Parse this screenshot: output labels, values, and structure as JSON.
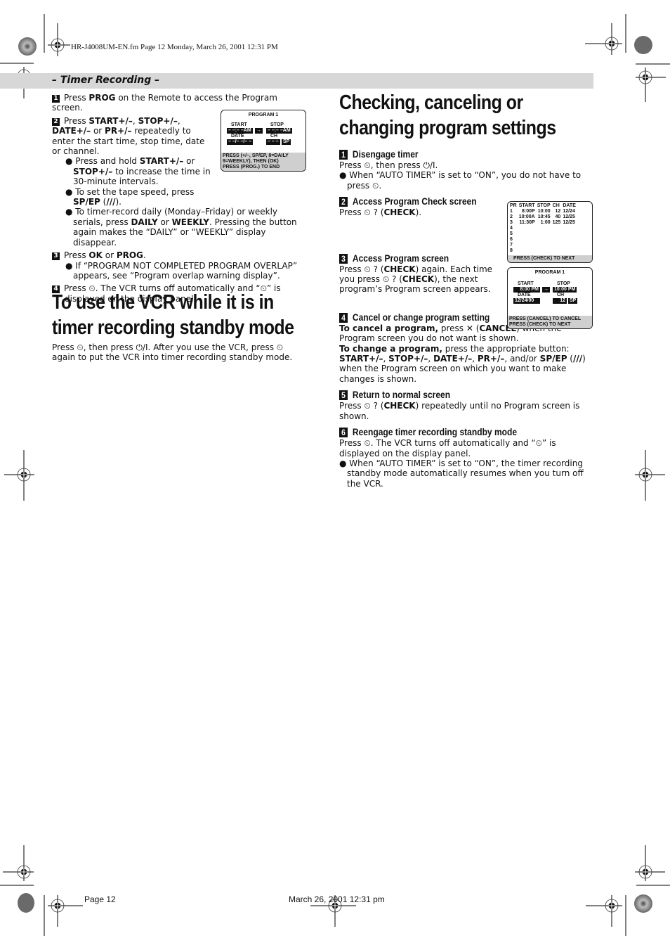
{
  "file_header": "HR-J4008UM-EN.fm  Page 12  Monday, March 26, 2001  12:31 PM",
  "section_title": "– Timer Recording –",
  "left": {
    "steps": [
      {
        "num": "1",
        "html_parts": [
          "Press ",
          "PROG",
          " on the Remote to access the Program screen."
        ]
      },
      {
        "num": "2",
        "text_a": "Press ",
        "b1": "START+/–",
        "t1": ", ",
        "b2": "STOP+/–",
        "t2": ", ",
        "b3": "DATE+/–",
        "t3": " or ",
        "b4": "PR+/–",
        "t4": " repeatedly to enter the start time, stop time, date or channel.",
        "bullets": [
          {
            "a": "Press and hold ",
            "b": "START+/–",
            "c": " or ",
            "d": "STOP+/–",
            "e": " to increase the time in 30-minute intervals."
          },
          {
            "a": "To set the tape speed, press ",
            "b": "SP/EP",
            "c": " (",
            "d": "///",
            "e": ")."
          },
          {
            "a": "To timer-record daily (Monday–Friday) or weekly serials, press ",
            "b": "DAILY",
            "c": " or ",
            "d": "WEEKLY",
            "e": ". Pressing the button again makes the “DAILY” or “WEEKLY” display disappear."
          }
        ]
      },
      {
        "num": "3",
        "a": "Press ",
        "b": "OK",
        "c": " or ",
        "d": "PROG",
        "e": ".",
        "bullet": "If “PROGRAM NOT COMPLETED PROGRAM OVERLAP” appears, see “Program overlap warning display”."
      },
      {
        "num": "4",
        "text": "Press ⏲. The VCR turns off automatically and “⏲” is displayed on the display panel."
      }
    ],
    "program_screen": {
      "title": "PROGRAM 1",
      "start_label": "START",
      "stop_label": "STOP",
      "start_value": "– –:– –AM",
      "stop_value": "– –:– –AM",
      "date_label": "DATE",
      "ch_label": "CH",
      "date_value": "– –/– –/– –",
      "ch_value": "– – –",
      "speed": "SP",
      "footer": [
        "PRESS (+/–, SP/EP, 8=DAILY",
        "9=WEEKLY), THEN (OK)",
        "PRESS (PROG.) TO END"
      ]
    },
    "heading": "To use the VCR while it is in timer recording standby mode",
    "paragraph": "Press ⏲, then press ⏻/I. After you use the VCR, press ⏲ again to put the VCR into timer recording standby mode."
  },
  "right": {
    "heading": "Checking, canceling or changing program settings",
    "steps": [
      {
        "num": "1",
        "title": "Disengage timer",
        "text": "Press ⏲, then press ⏻/I.",
        "bullet": "When “AUTO TIMER” is set to “ON”, you do not have to press ⏲."
      },
      {
        "num": "2",
        "title": "Access Program Check screen",
        "a": "Press ⏲ ? (",
        "b": "CHECK",
        "c": ")."
      },
      {
        "num": "3",
        "title": "Access Program screen",
        "a": "Press ⏲ ? (",
        "b": "CHECK",
        "c": ") again. Each time you press ⏲ ? (",
        "d": "CHECK",
        "e": "), the next program’s Program screen appears."
      },
      {
        "num": "4",
        "title": "Cancel or change program setting",
        "cancel_b": "To cancel a program,",
        "cancel_a": " press ✕ (",
        "cancel_c": "CANCEL",
        "cancel_d": ") when the Program screen you do not want is shown.",
        "change_b": "To change a program,",
        "change_a": " press the appropriate button: ",
        "btns1": "START+/–",
        "sep1": ", ",
        "btns2": "STOP+/–",
        "sep2": ", ",
        "btns3": "DATE+/–",
        "sep3": ", ",
        "btns4": "PR+/–",
        "sep4": ", and/or ",
        "btns5": "SP/EP",
        "sep5": " (",
        "btns6": "///",
        "tail": ") when the Program screen on which you want to make changes is shown."
      },
      {
        "num": "5",
        "title": "Return to normal screen",
        "a": "Press ⏲ ? (",
        "b": "CHECK",
        "c": ") repeatedly until no Program screen is shown."
      },
      {
        "num": "6",
        "title": "Reengage timer recording standby mode",
        "text": "Press ⏲. The VCR turns off automatically and “⏲” is displayed on the display panel.",
        "bullet": "When “AUTO TIMER” is set to “ON”, the timer recording standby mode automatically resumes when you turn off the VCR."
      }
    ],
    "check_screen": {
      "headers": [
        "PR",
        "START",
        "STOP",
        "CH",
        "DATE"
      ],
      "rows": [
        [
          "1",
          "8:00P",
          "10:00",
          "12",
          "12/24"
        ],
        [
          "2",
          "10:00A",
          "10:45",
          "40",
          "12/25"
        ],
        [
          "3",
          "11:30P",
          "1:00",
          "125",
          "12/25"
        ],
        [
          "4",
          "",
          "",
          "",
          ""
        ],
        [
          "5",
          "",
          "",
          "",
          ""
        ],
        [
          "6",
          "",
          "",
          "",
          ""
        ],
        [
          "7",
          "",
          "",
          "",
          ""
        ],
        [
          "8",
          "",
          "",
          "",
          ""
        ]
      ],
      "footer": "PRESS (CHECK) TO NEXT"
    },
    "program_screen": {
      "title": "PROGRAM 1",
      "start_label": "START",
      "stop_label": "STOP",
      "start_value": "8:00 PM",
      "stop_value": "10:00 PM",
      "date_label": "DATE",
      "ch_label": "CH",
      "date_value": "12/24/00",
      "ch_value": "12",
      "speed": "SP",
      "footer": [
        "PRESS (CANCEL) TO CANCEL",
        "PRESS (CHECK) TO NEXT"
      ]
    }
  },
  "footer": {
    "page": "Page 12",
    "date": "March 26, 2001 12:31 pm"
  }
}
